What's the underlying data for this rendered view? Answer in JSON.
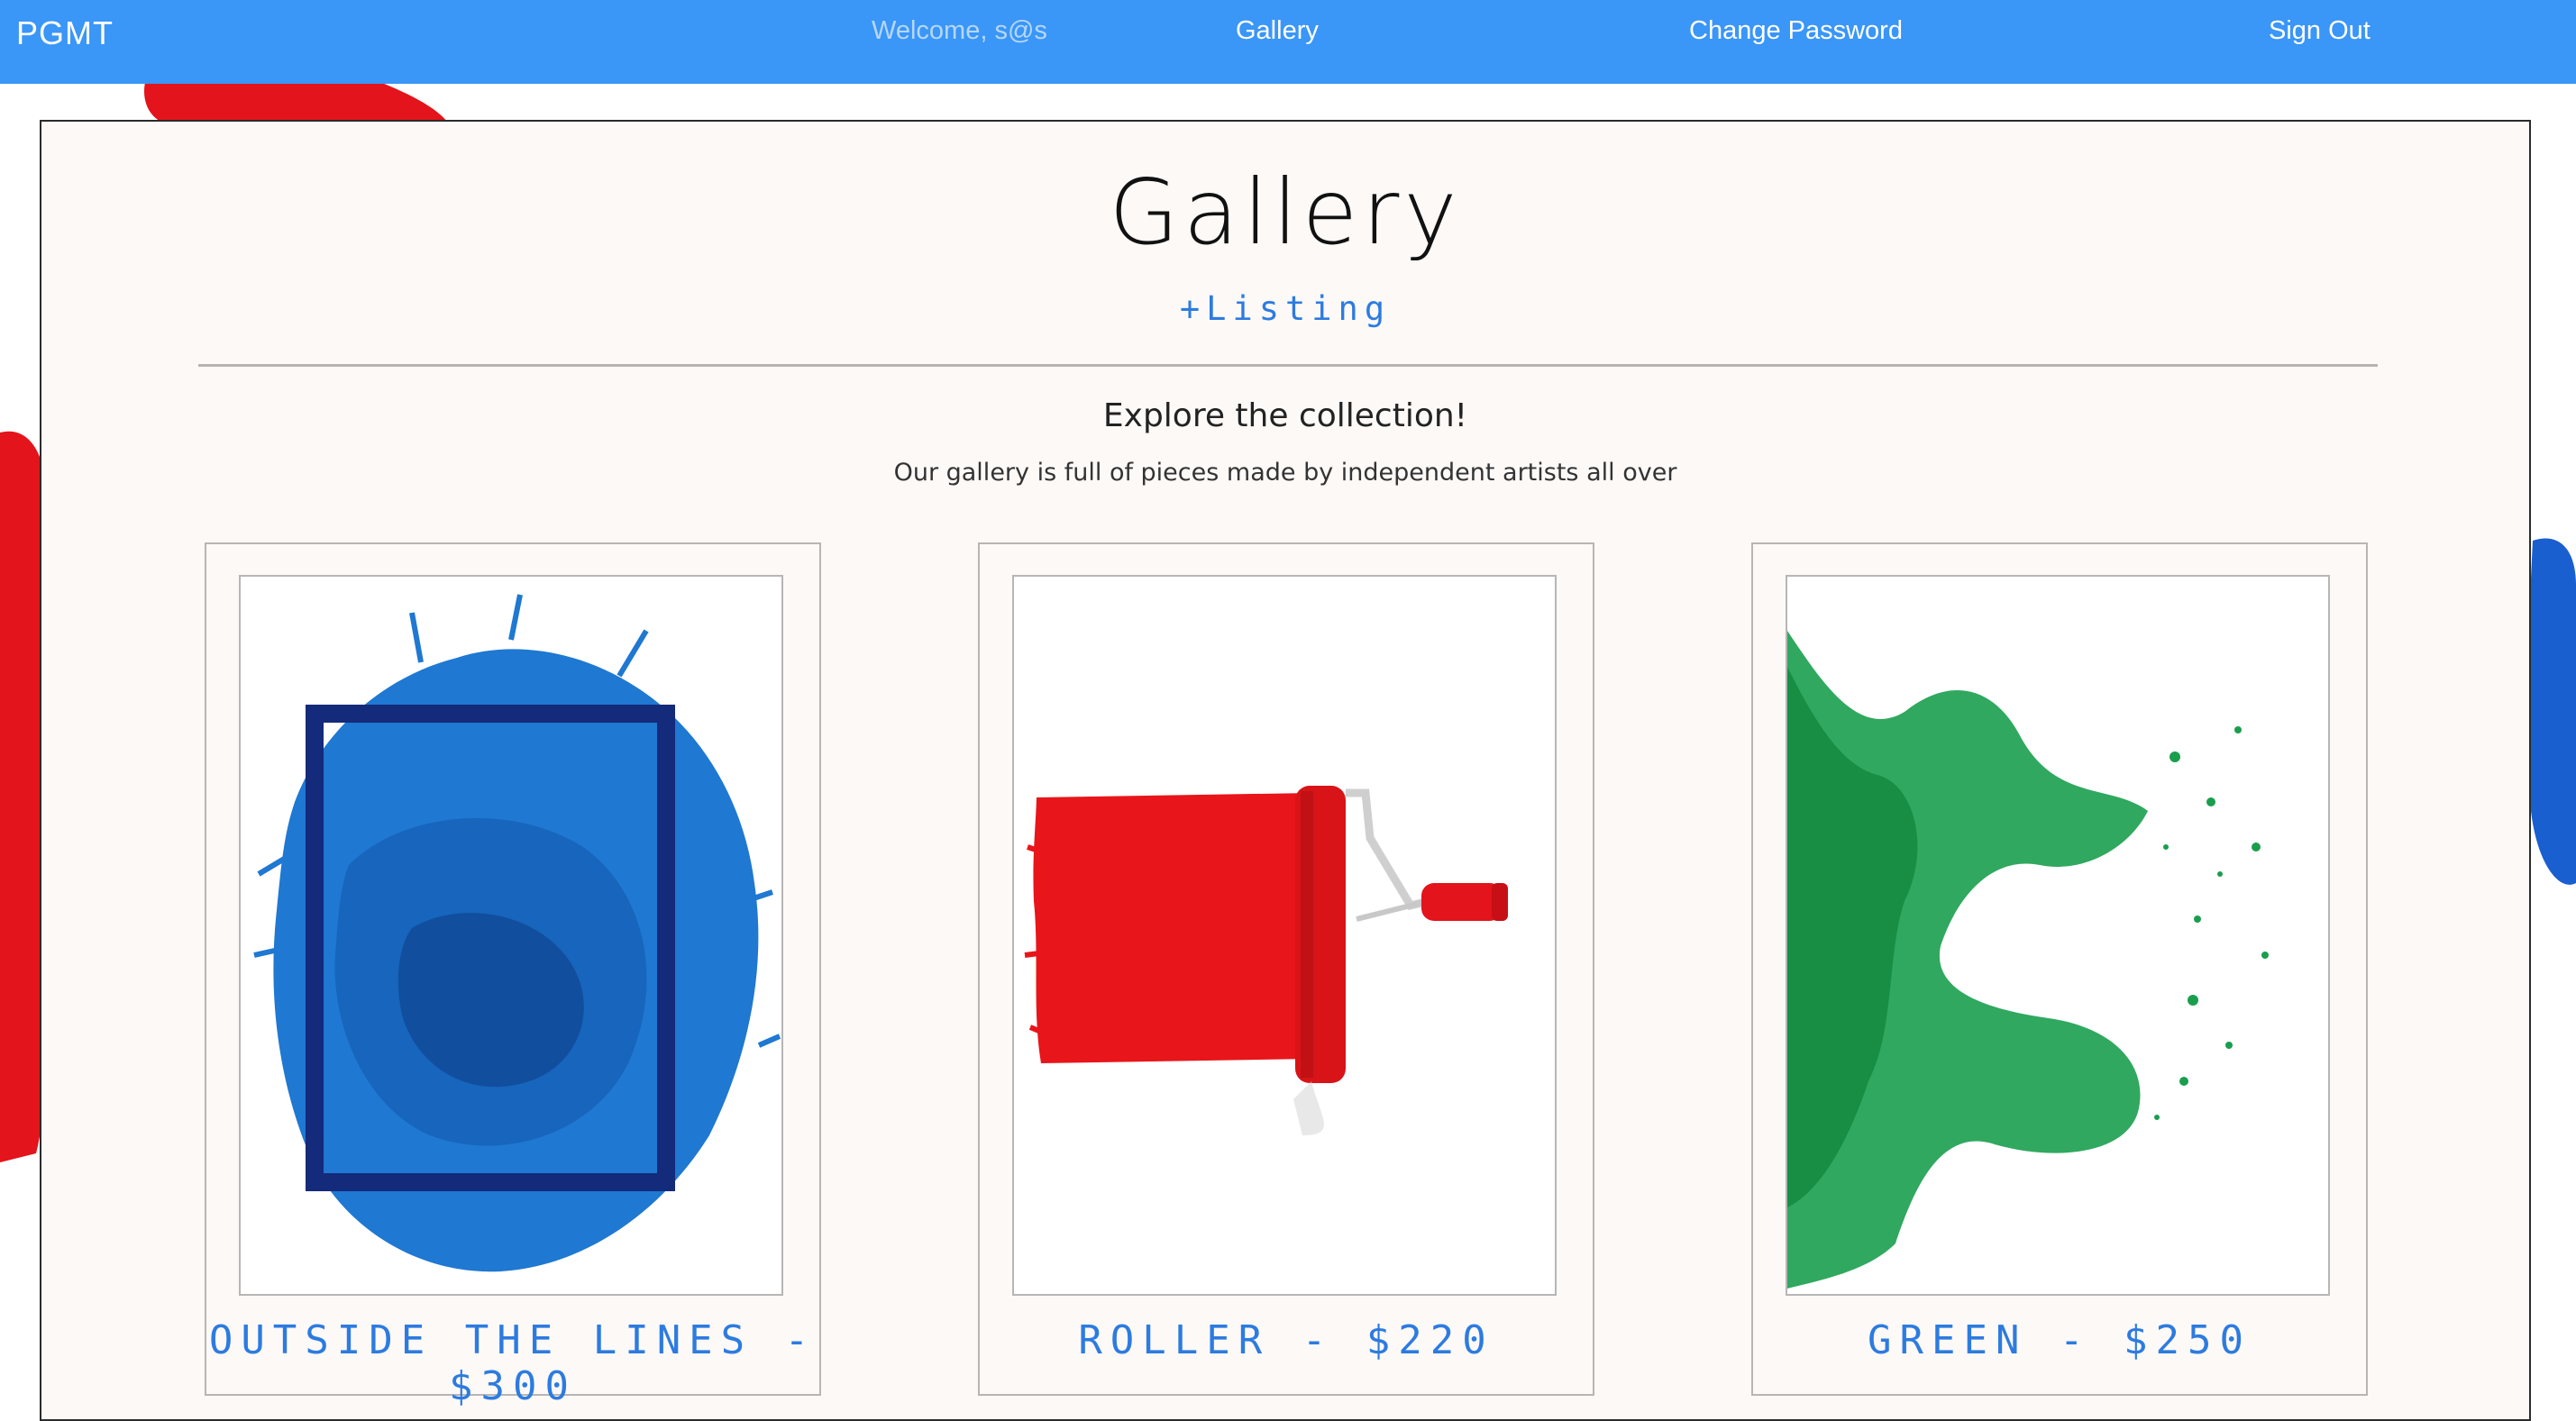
{
  "navbar": {
    "brand": "PGMT",
    "welcome": "Welcome, s@s",
    "gallery": "Gallery",
    "change_password": "Change Password",
    "sign_out": "Sign Out"
  },
  "page": {
    "title": "Gallery",
    "add_listing": "+Listing",
    "explore_title": "Explore the collection!",
    "explore_subtitle": "Our gallery is full of pieces made by independent artists all over"
  },
  "listings": [
    {
      "caption": "OUTSIDE THE LINES - $300"
    },
    {
      "caption": "ROLLER - $220"
    },
    {
      "caption": "GREEN - $250"
    }
  ],
  "colors": {
    "navbar": "#3a96f7",
    "accent": "#2d7be0",
    "panel_bg": "#fcf9f7"
  }
}
